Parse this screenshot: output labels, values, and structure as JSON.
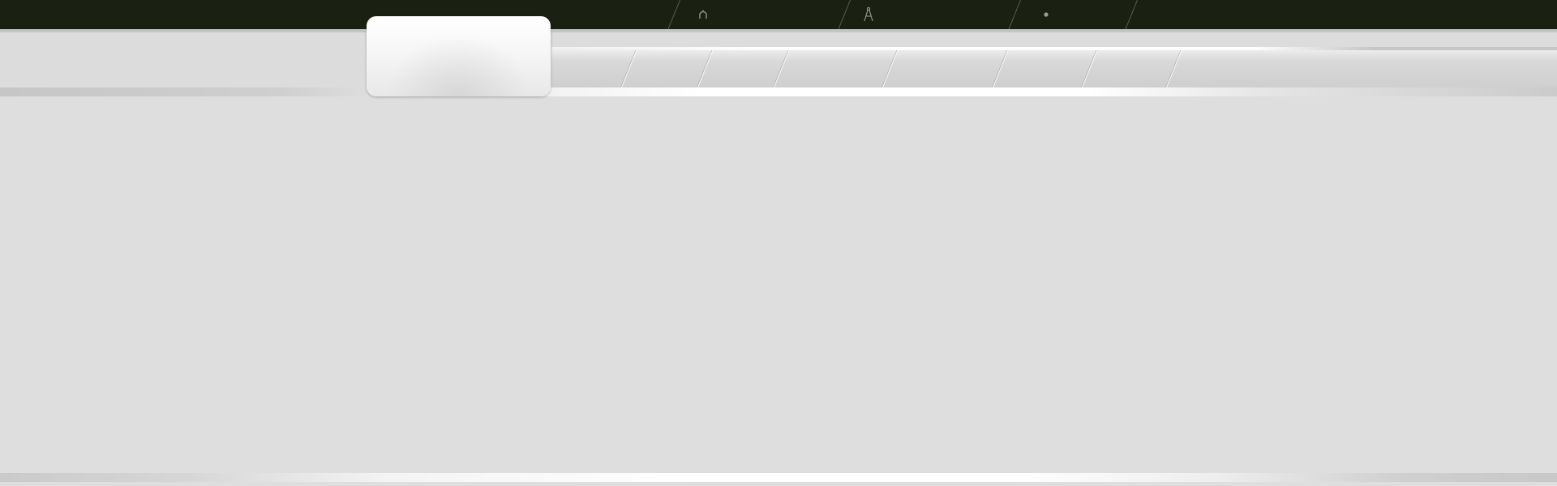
{
  "topbar": {
    "items": [
      {
        "icon": "home-icon"
      },
      {
        "icon": "compass-drawing-icon"
      },
      {
        "icon": "dot-icon"
      }
    ]
  },
  "tabs": {
    "active_index": 0,
    "count": 8
  },
  "colors": {
    "topbar_bg": "#1a2113",
    "page_bg": "#dedede",
    "icon_color": "#9a9f94"
  }
}
